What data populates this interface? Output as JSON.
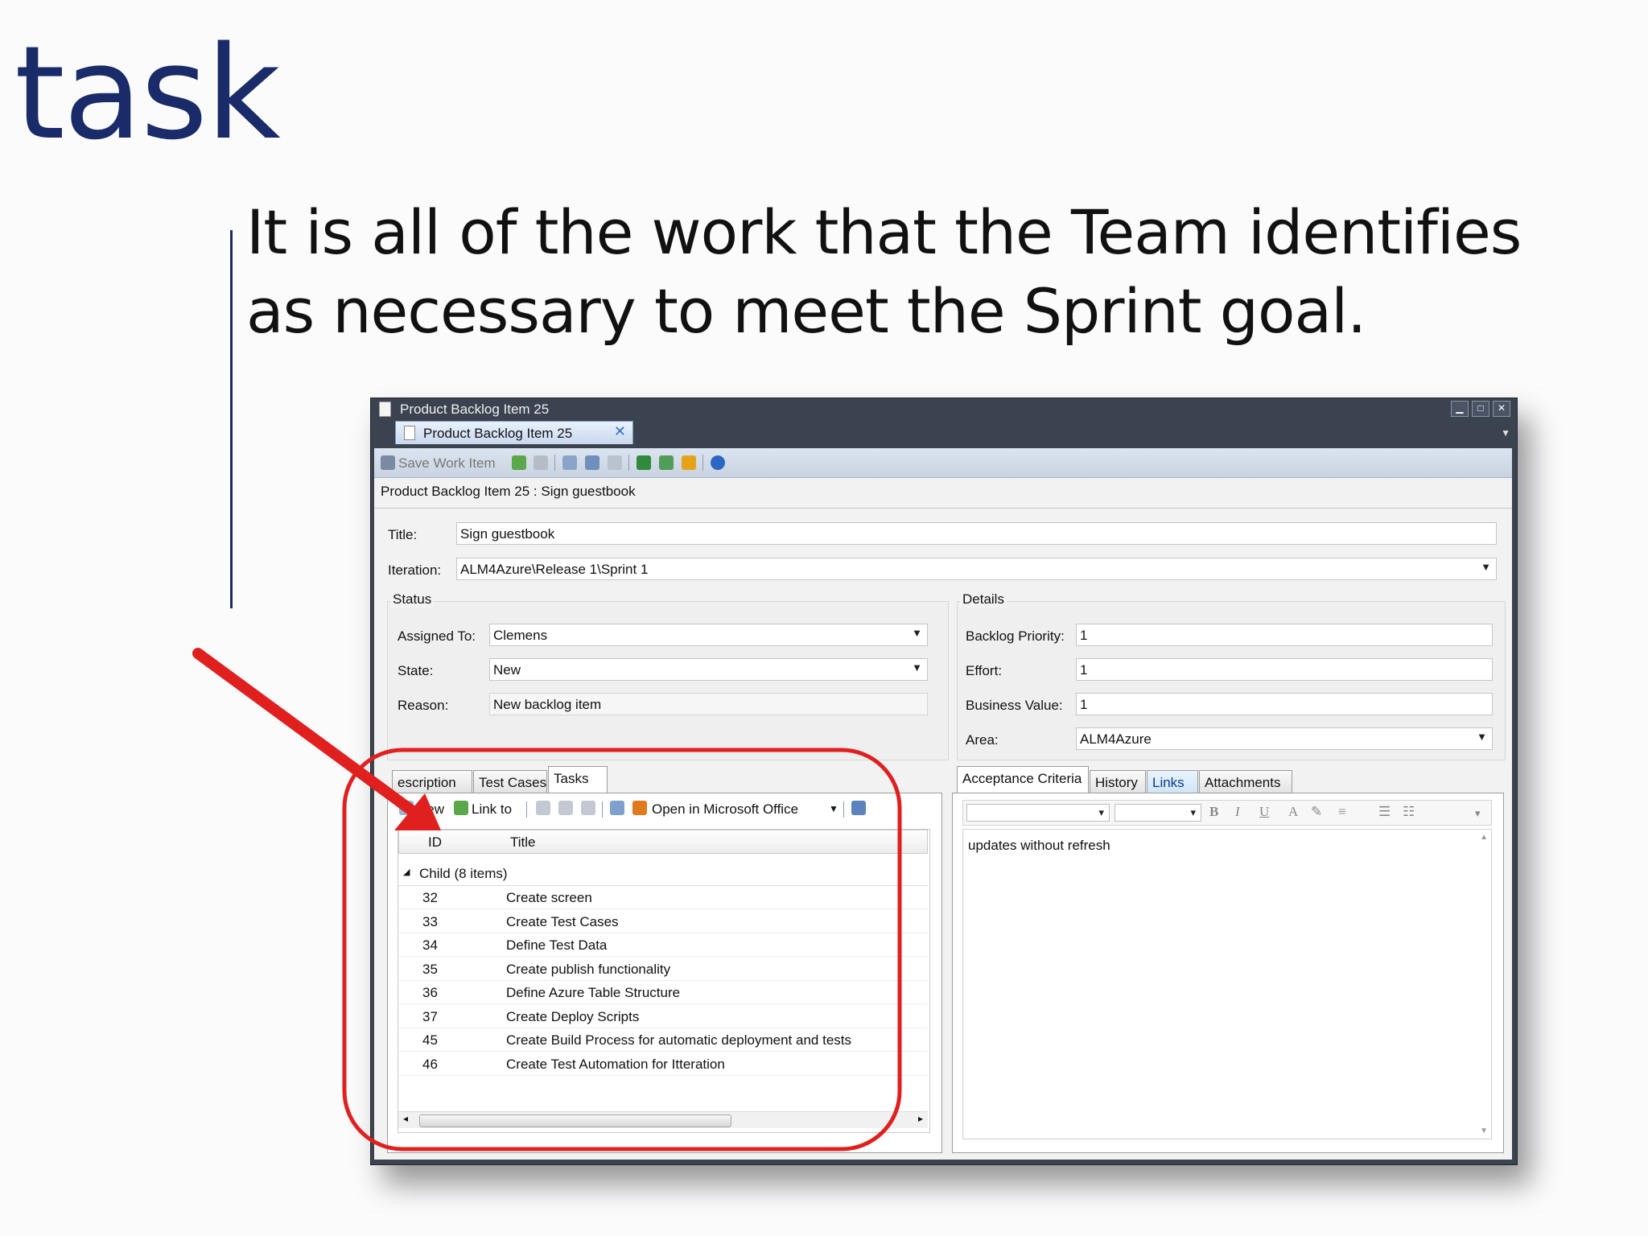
{
  "slide": {
    "title": "task",
    "body": "It is all of the work that the Team identifies as necessary to meet the Sprint goal."
  },
  "window": {
    "title": "Product Backlog Item 25",
    "tab_label": "Product Backlog Item 25",
    "toolbar": {
      "save_label": "Save Work Item"
    },
    "breadcrumb": "Product Backlog Item 25 : Sign guestbook",
    "fields": {
      "title_label": "Title:",
      "title_value": "Sign guestbook",
      "iteration_label": "Iteration:",
      "iteration_value": "ALM4Azure\\Release 1\\Sprint 1"
    },
    "status": {
      "group_title": "Status",
      "assigned_label": "Assigned To:",
      "assigned_value": "Clemens",
      "state_label": "State:",
      "state_value": "New",
      "reason_label": "Reason:",
      "reason_value": "New backlog item"
    },
    "details": {
      "group_title": "Details",
      "priority_label": "Backlog Priority:",
      "priority_value": "1",
      "effort_label": "Effort:",
      "effort_value": "1",
      "business_label": "Business Value:",
      "business_value": "1",
      "area_label": "Area:",
      "area_value": "ALM4Azure"
    },
    "left_tabs": [
      "escription",
      "Test Cases",
      "Tasks"
    ],
    "tasks_toolbar": {
      "new_label": "New",
      "link_label": "Link to",
      "office_label": "Open in Microsoft Office"
    },
    "grid": {
      "col_id": "ID",
      "col_title": "Title",
      "group_label": "Child (8 items)",
      "rows": [
        {
          "id": "32",
          "title": "Create screen"
        },
        {
          "id": "33",
          "title": "Create Test Cases"
        },
        {
          "id": "34",
          "title": "Define Test Data"
        },
        {
          "id": "35",
          "title": "Create publish functionality"
        },
        {
          "id": "36",
          "title": "Define Azure Table Structure"
        },
        {
          "id": "37",
          "title": "Create Deploy Scripts"
        },
        {
          "id": "45",
          "title": "Create Build Process for automatic deployment and tests"
        },
        {
          "id": "46",
          "title": "Create Test Automation for Itteration"
        }
      ]
    },
    "right_tabs": [
      "Acceptance Criteria",
      "History",
      "Links",
      "Attachments"
    ],
    "acceptance_text": "updates without refresh"
  },
  "colors": {
    "title_blue": "#1a2b6a",
    "annotation_red": "#e0201e",
    "window_dark": "#3b4350"
  },
  "icons": [
    "doc-icon",
    "close-icon",
    "minimize-icon",
    "maximize-icon",
    "save-icon",
    "refresh-icon",
    "undo-icon",
    "excel-icon",
    "help-icon",
    "new-task-icon",
    "link-icon",
    "office-icon",
    "dropdown-arrow-icon",
    "annotation-arrow"
  ]
}
